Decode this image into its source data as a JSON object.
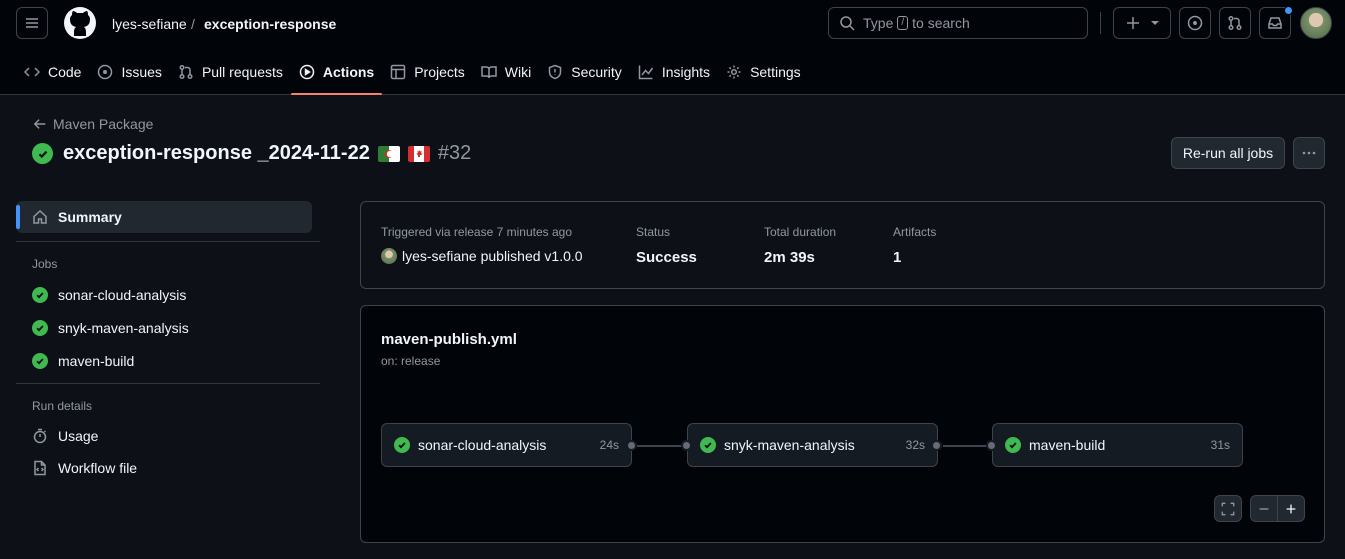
{
  "header": {
    "owner": "lyes-sefiane",
    "separator": "/",
    "repo": "exception-response",
    "search_prefix": "Type",
    "search_key": "/",
    "search_suffix": "to search"
  },
  "tabs": [
    {
      "label": "Code",
      "icon": "code-icon"
    },
    {
      "label": "Issues",
      "icon": "issue-icon"
    },
    {
      "label": "Pull requests",
      "icon": "pull-request-icon"
    },
    {
      "label": "Actions",
      "icon": "play-icon",
      "active": true
    },
    {
      "label": "Projects",
      "icon": "table-icon"
    },
    {
      "label": "Wiki",
      "icon": "book-icon"
    },
    {
      "label": "Security",
      "icon": "shield-icon"
    },
    {
      "label": "Insights",
      "icon": "graph-icon"
    },
    {
      "label": "Settings",
      "icon": "gear-icon"
    }
  ],
  "run": {
    "back_label": "Maven Package",
    "title": "exception-response _2024-11-22",
    "number": "#32",
    "rerun_label": "Re-run all jobs"
  },
  "sidebar": {
    "summary_label": "Summary",
    "jobs_heading": "Jobs",
    "jobs": [
      "sonar-cloud-analysis",
      "snyk-maven-analysis",
      "maven-build"
    ],
    "run_details_heading": "Run details",
    "usage_label": "Usage",
    "workflow_file_label": "Workflow file"
  },
  "summary": {
    "trigger_label": "Triggered via release 7 minutes ago",
    "trigger_value": "lyes-sefiane published v1.0.0",
    "status_label": "Status",
    "status_value": "Success",
    "duration_label": "Total duration",
    "duration_value": "2m 39s",
    "artifacts_label": "Artifacts",
    "artifacts_value": "1"
  },
  "workflow": {
    "file": "maven-publish.yml",
    "event": "on: release",
    "jobs": [
      {
        "name": "sonar-cloud-analysis",
        "duration": "24s"
      },
      {
        "name": "snyk-maven-analysis",
        "duration": "32s"
      },
      {
        "name": "maven-build",
        "duration": "31s"
      }
    ]
  },
  "colors": {
    "success": "#3fb950",
    "accent": "#f78166",
    "link": "#4493f8"
  }
}
